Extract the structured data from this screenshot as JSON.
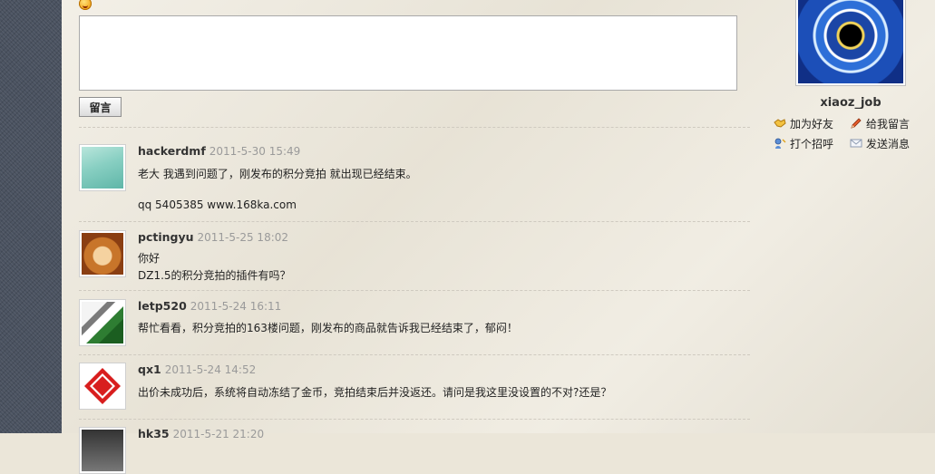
{
  "composer": {
    "submit_label": "留言"
  },
  "messages": [
    {
      "author": "hackerdmf",
      "time": "2011-5-30 15:49",
      "lines": [
        "老大 我遇到问题了，刚发布的积分竞拍 就出现已经结束。",
        "",
        "qq 5405385  www.168ka.com"
      ]
    },
    {
      "author": "pctingyu",
      "time": "2011-5-25 18:02",
      "lines": [
        "你好",
        "DZ1.5的积分竞拍的插件有吗？"
      ]
    },
    {
      "author": "letp520",
      "time": "2011-5-24 16:11",
      "lines": [
        "帮忙看看，积分竞拍的163楼问题，刚发布的商品就告诉我已经结束了，郁闷！"
      ]
    },
    {
      "author": "qx1",
      "time": "2011-5-24 14:52",
      "lines": [
        "出价未成功后，系统将自动冻结了金币，竞拍结束后并没返还。请问是我这里没设置的不对?还是？"
      ]
    },
    {
      "author": "hk35",
      "time": "2011-5-21 21:20",
      "lines": []
    }
  ],
  "sidebar": {
    "username": "xiaoz_job",
    "actions": {
      "add_friend": "加为好友",
      "leave_message": "给我留言",
      "greet": "打个招呼",
      "send_message": "发送消息"
    }
  },
  "icons": {
    "smiley": "smiley-icon",
    "add_friend": "handshake-icon",
    "leave_message": "pencil-icon",
    "greet": "wave-icon",
    "send_message": "envelope-icon"
  },
  "colors": {
    "paper_background": "#ece7da",
    "denim_border": "#4a5260",
    "timestamp_gray": "#9a9a9a"
  }
}
